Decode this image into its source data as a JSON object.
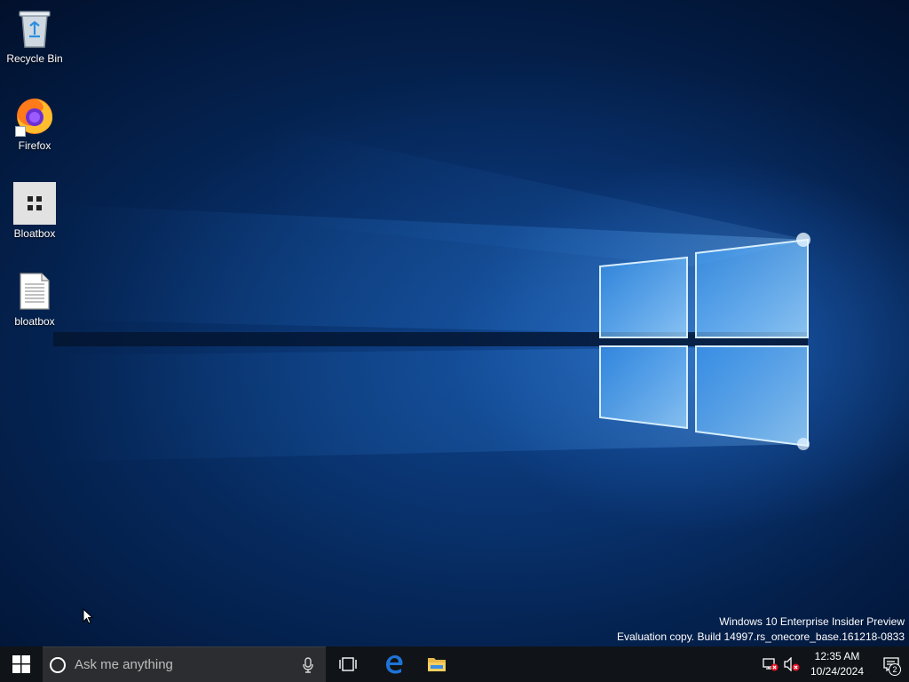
{
  "desktop": {
    "icons": [
      {
        "label": "Recycle Bin",
        "icon": "recycle-bin-icon"
      },
      {
        "label": "Firefox",
        "icon": "firefox-icon"
      },
      {
        "label": "Bloatbox",
        "icon": "bloatbox-app-icon"
      },
      {
        "label": "bloatbox",
        "icon": "text-file-icon"
      }
    ],
    "watermark": {
      "line1": "Windows 10 Enterprise Insider Preview",
      "line2": "Evaluation copy. Build 14997.rs_onecore_base.161218-0833"
    }
  },
  "taskbar": {
    "start_icon": "windows-logo-icon",
    "search": {
      "placeholder": "Ask me anything",
      "cortana_icon": "cortana-circle-icon",
      "mic_icon": "microphone-icon"
    },
    "pinned": [
      {
        "name": "Task View",
        "icon": "task-view-icon"
      },
      {
        "name": "Microsoft Edge",
        "icon": "edge-icon"
      },
      {
        "name": "File Explorer",
        "icon": "file-explorer-icon"
      }
    ],
    "tray": {
      "network_icon": "network-disconnected-icon",
      "volume_icon": "volume-muted-icon",
      "time": "12:35 AM",
      "date": "10/24/2024",
      "notifications_icon": "action-center-icon",
      "notification_count": "2"
    },
    "colors": {
      "taskbar_bg": "#101418",
      "search_bg": "#2b2d30",
      "accent_blue": "#1e73d8"
    }
  }
}
